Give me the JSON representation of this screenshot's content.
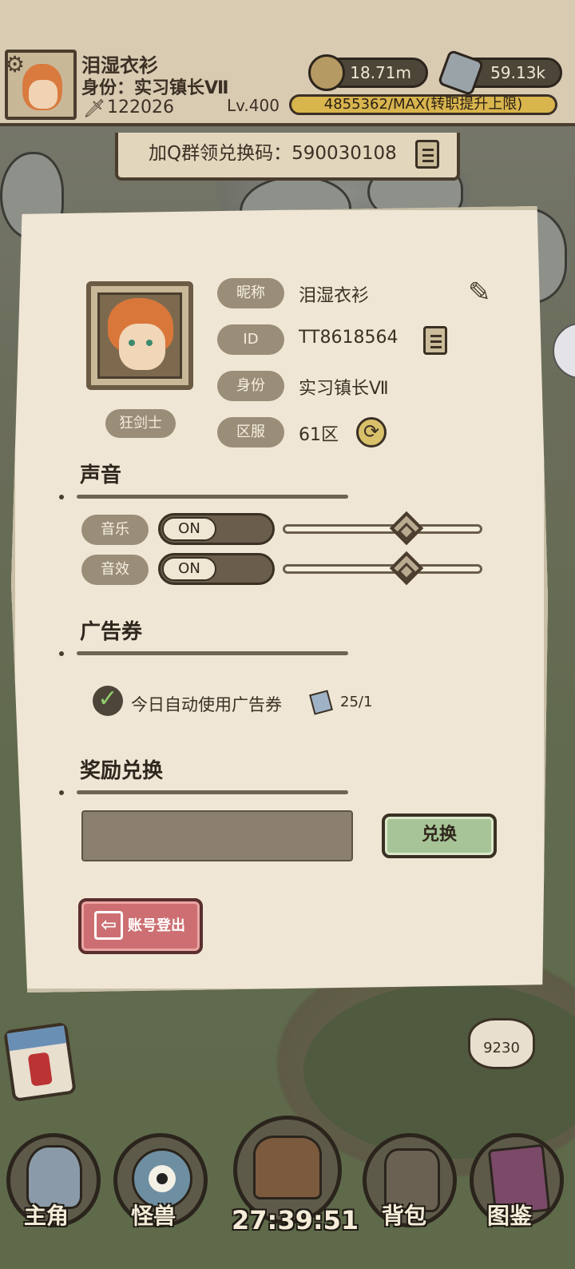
{
  "header": {
    "player_name": "泪湿衣衫",
    "player_title": "身份：实习镇长Ⅶ",
    "power": "122026",
    "level": "Lv.400",
    "xp_text": "4855362/MAX(转职提升上限)",
    "coins": "18.71m",
    "stones": "59.13k"
  },
  "qq_banner": {
    "text": "加Q群领兑换码：590030108"
  },
  "profile": {
    "class_label": "狂剑士",
    "nickname_label": "昵称",
    "nickname": "泪湿衣衫",
    "id_label": "ID",
    "id_value": "TT8618564",
    "identity_label": "身份",
    "identity": "实习镇长Ⅶ",
    "server_label": "区服",
    "server": "61区"
  },
  "sound": {
    "title": "声音",
    "music_label": "音乐",
    "music_toggle": "ON",
    "music_volume": 0.62,
    "sfx_label": "音效",
    "sfx_toggle": "ON",
    "sfx_volume": 0.62
  },
  "ads": {
    "title": "广告券",
    "auto_use_label": "今日自动使用广告券",
    "auto_use_checked": true,
    "ticket_count": "25/1"
  },
  "reward": {
    "title": "奖励兑换",
    "input_value": "",
    "redeem_button": "兑换"
  },
  "logout_button": "账号登出",
  "bottom_nav": {
    "items": [
      {
        "label": "主角"
      },
      {
        "label": "怪兽"
      },
      {
        "label": "背包"
      },
      {
        "label": "图鉴"
      }
    ],
    "timer": "27:39:51"
  },
  "map_labels": {
    "bubble_value": "9230"
  }
}
